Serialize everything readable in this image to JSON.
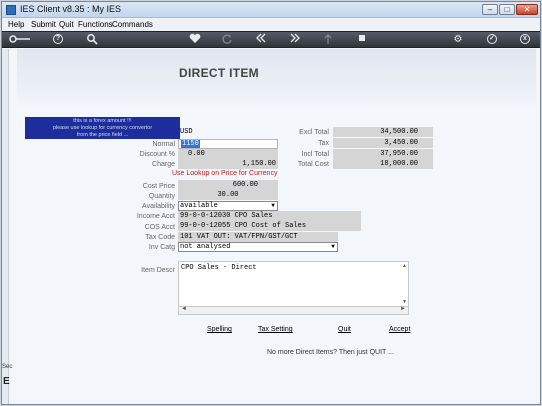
{
  "window": {
    "title": "IES Client v8.35 : My IES",
    "minimize_label": "–",
    "maximize_label": "□",
    "close_label": "✕"
  },
  "menu": [
    "Help",
    "Submit",
    "Quit",
    "Functions",
    "Commands"
  ],
  "toolbar": {
    "icons": [
      "key-icon",
      "help-icon",
      "search-icon",
      "heart-icon",
      "refresh-icon",
      "rewind-icon",
      "fast-forward-icon",
      "upload-icon",
      "stop-icon",
      "settings-icon",
      "check-icon",
      "close-icon"
    ],
    "help_glyph": "?",
    "settings_glyph": "⚙",
    "check_glyph": "✓",
    "close_glyph": "x"
  },
  "left_strip": {
    "section_label": "Sec",
    "marker": "E"
  },
  "form": {
    "heading": "DIRECT ITEM",
    "tooltip_lines": [
      "this is a forex amount !!!",
      "please use lookup for currency convertor",
      "from the price field ..."
    ],
    "currency_value": "USD",
    "normal_label": "Normal",
    "normal_value": "1150",
    "discount_label": "Discount %",
    "discount_value": "0.00",
    "charge_label": "Charge",
    "charge_value": "1,150.00",
    "warning": "Use Lookup on Price for Currency",
    "cost_price_label": "Cost Price",
    "cost_price_value": "600.00",
    "quantity_label": "Quantity",
    "quantity_value": "30.00",
    "availability_label": "Availability",
    "availability_value": "available",
    "income_label": "Income Acct",
    "income_value": "99-0-0-12030 CPO Sales",
    "cos_label": "COS Acct",
    "cos_value": "99-0-0-12055 CPO Cost of Sales",
    "taxcode_label": "Tax Code",
    "taxcode_value": "101 VAT OUT: VAT/FPN/GST/GCT",
    "invcatg_label": "Inv Catg",
    "invcatg_value": "not analysed",
    "descr_label": "Item Descr",
    "descr_value": "CPO Sales - Direct",
    "dropdown_arrow": "▼",
    "scroll_up": "▲",
    "scroll_down": "▼",
    "scroll_left": "◄",
    "scroll_right": "►"
  },
  "totals": {
    "excl_label": "Excl Total",
    "excl_value": "34,500.00",
    "tax_label": "Tax",
    "tax_value": "3,450.00",
    "incl_label": "Incl Total",
    "incl_value": "37,950.00",
    "cost_label": "Total Cost",
    "cost_value": "18,000.00"
  },
  "actions": {
    "spelling": "Spelling",
    "tax_setting": "Tax Setting",
    "quit": "Quit",
    "accept": "Accept"
  },
  "footer": "No more Direct Items? Then just QUIT ..."
}
